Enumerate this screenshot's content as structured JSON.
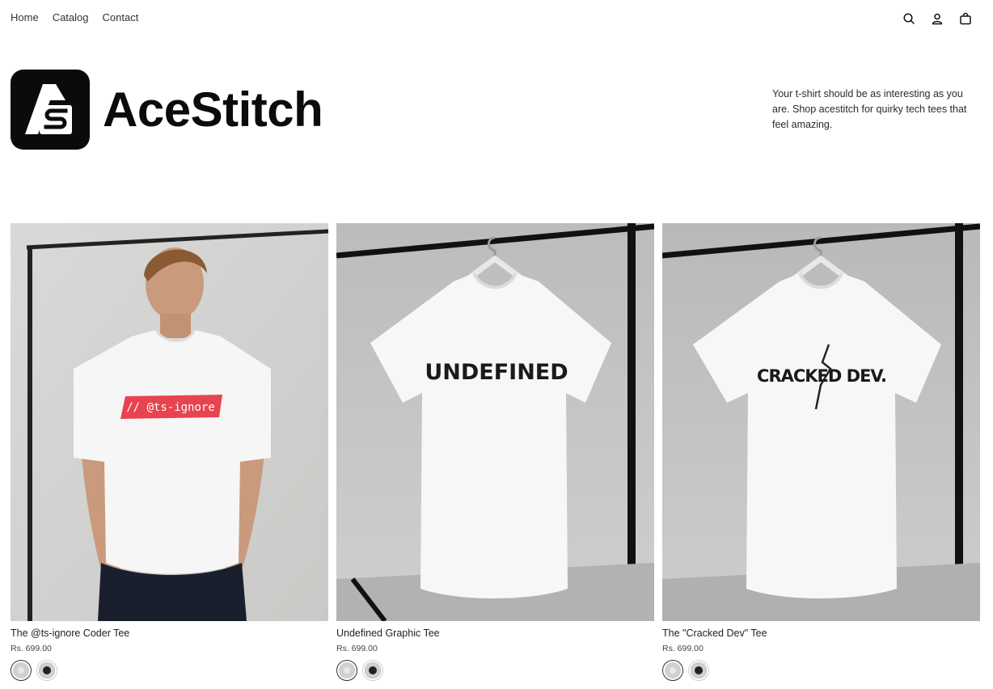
{
  "nav": {
    "links": [
      "Home",
      "Catalog",
      "Contact"
    ],
    "icons": [
      "search-icon",
      "account-icon",
      "cart-icon"
    ]
  },
  "brand": {
    "name": "AceStitch",
    "tagline": "Your t-shirt should be as interesting as you are. Shop acestitch for quirky tech tees that feel amazing."
  },
  "products": [
    {
      "title": "The @ts-ignore Coder Tee",
      "price": "Rs. 699.00",
      "print": "// @ts-ignore",
      "swatches": [
        "white",
        "black"
      ]
    },
    {
      "title": "Undefined Graphic Tee",
      "price": "Rs. 699.00",
      "print": "UNDEFINED",
      "swatches": [
        "white",
        "black"
      ]
    },
    {
      "title": "The \"Cracked Dev\" Tee",
      "price": "Rs. 699.00",
      "print": "CRACKED DEV.",
      "swatches": [
        "white",
        "black"
      ]
    }
  ],
  "colors": {
    "accent_red": "#e8434f",
    "backdrop": "#cfd0ce",
    "ink": "#0b0b0b"
  }
}
